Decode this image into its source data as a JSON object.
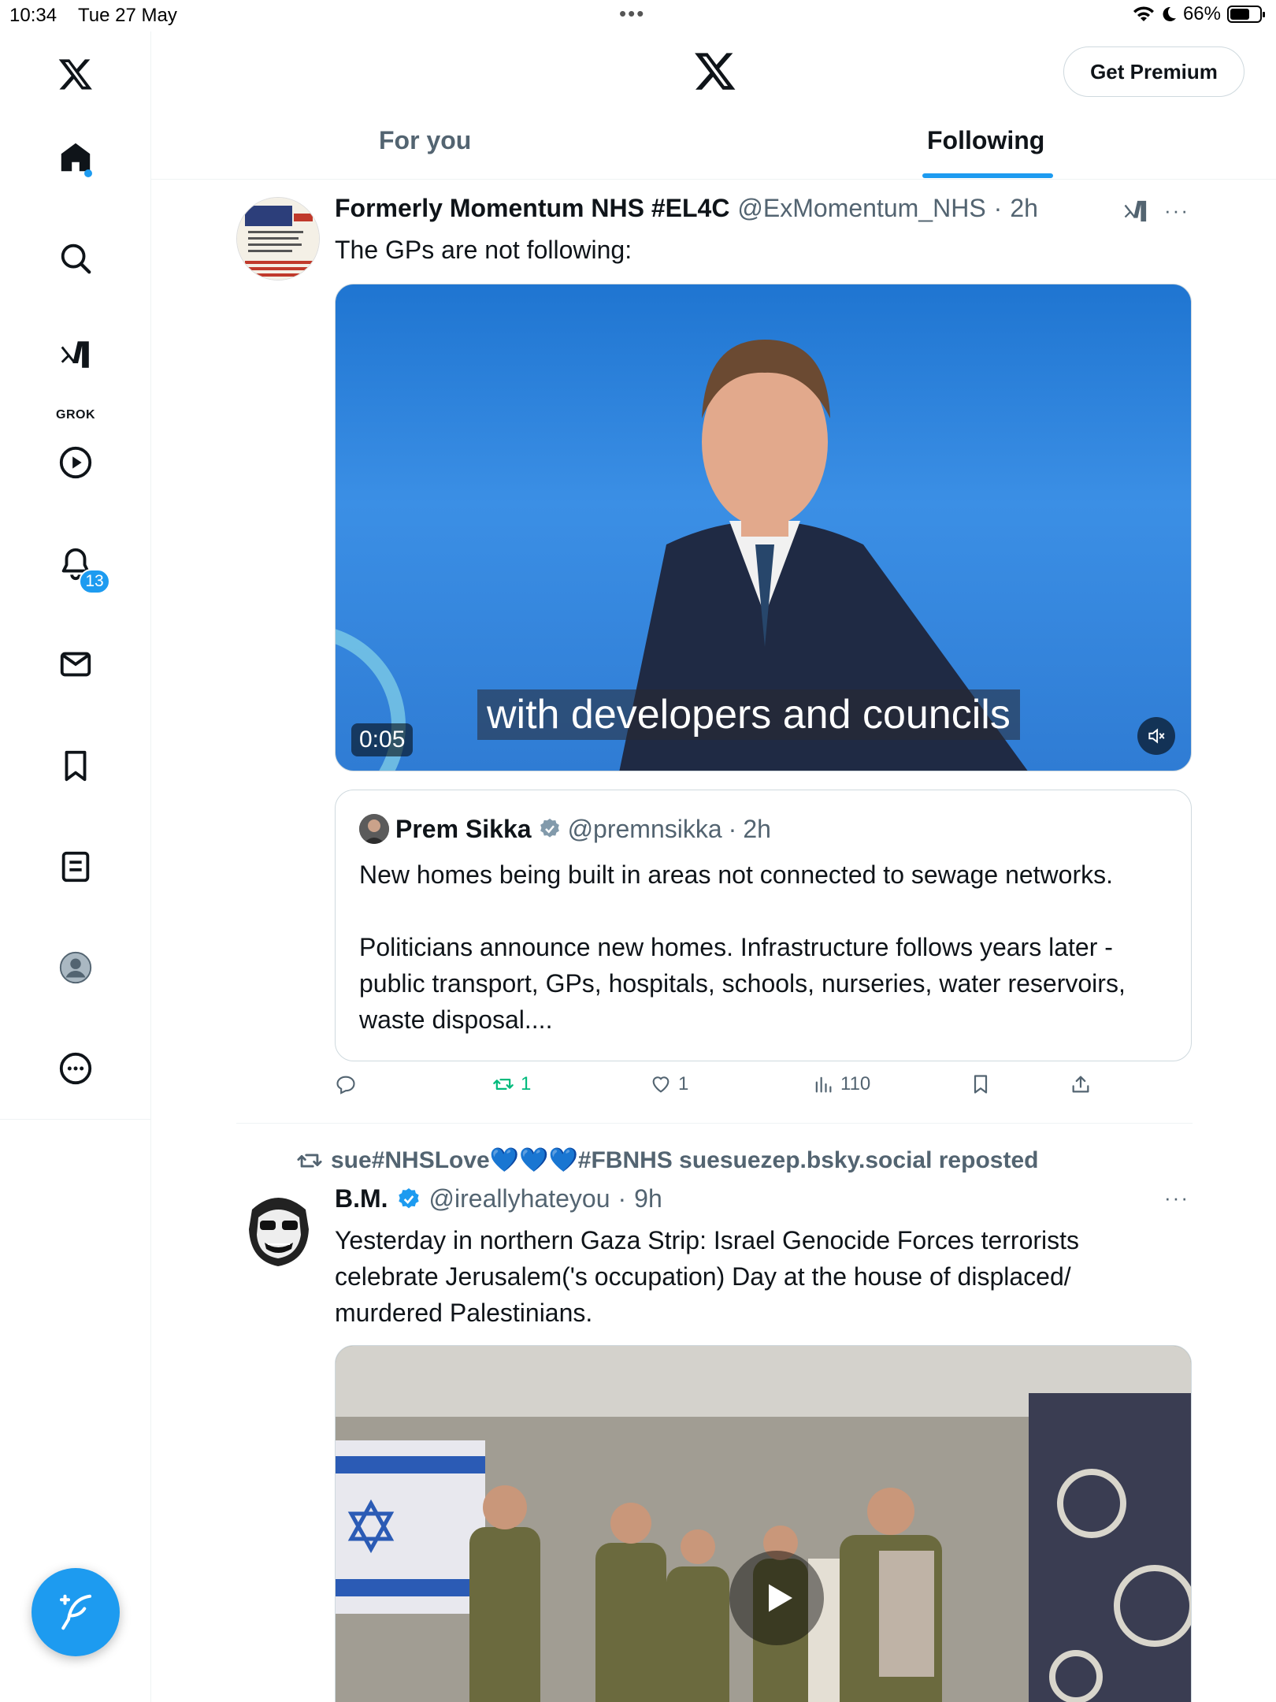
{
  "status_bar": {
    "time": "10:34",
    "date": "Tue 27 May",
    "battery_percent": "66%",
    "battery_level": 0.66
  },
  "sidebar": {
    "grok_label": "GROK",
    "notifications_count": "13",
    "items": [
      "x-logo",
      "home-icon",
      "search-icon",
      "grok-icon",
      "video-icon",
      "notifications-icon",
      "messages-icon",
      "bookmarks-icon",
      "lists-icon",
      "profile-icon",
      "more-icon"
    ]
  },
  "header": {
    "premium_label": "Get Premium",
    "tabs": [
      {
        "label": "For you",
        "active": false
      },
      {
        "label": "Following",
        "active": true
      }
    ]
  },
  "colors": {
    "accent": "#1d9bf0",
    "text_primary": "#0f1419",
    "text_secondary": "#536471",
    "retweet_green": "#00ba7c"
  },
  "tweets": [
    {
      "name": "Formerly Momentum NHS #EL4C",
      "handle": "@ExMomentum_NHS",
      "time": "2h",
      "text": "The GPs are not following:",
      "video": {
        "duration": "0:05",
        "caption": "with developers and councils"
      },
      "quote": {
        "name": "Prem Sikka",
        "handle": "@premnsikka",
        "time": "2h",
        "paragraphs": [
          "New homes being built in areas not connected to sewage networks.",
          "Politicians announce new homes. Infrastructure follows years later - public transport, GPs, hospitals, schools, nurseries, water reservoirs, waste disposal...."
        ]
      },
      "actions": {
        "replies": "",
        "retweets": "1",
        "likes": "1",
        "views": "110"
      }
    },
    {
      "repost_by": "sue#NHSLove💙💙💙#FBNHS suesuezep.bsky.social reposted",
      "name": "B.M.",
      "handle": "@ireallyhateyou",
      "time": "9h",
      "text": "Yesterday in northern Gaza Strip: Israel Genocide Forces terrorists celebrate Jerusalem('s occupation) Day at the house of displaced/ murdered Palestinians."
    }
  ]
}
